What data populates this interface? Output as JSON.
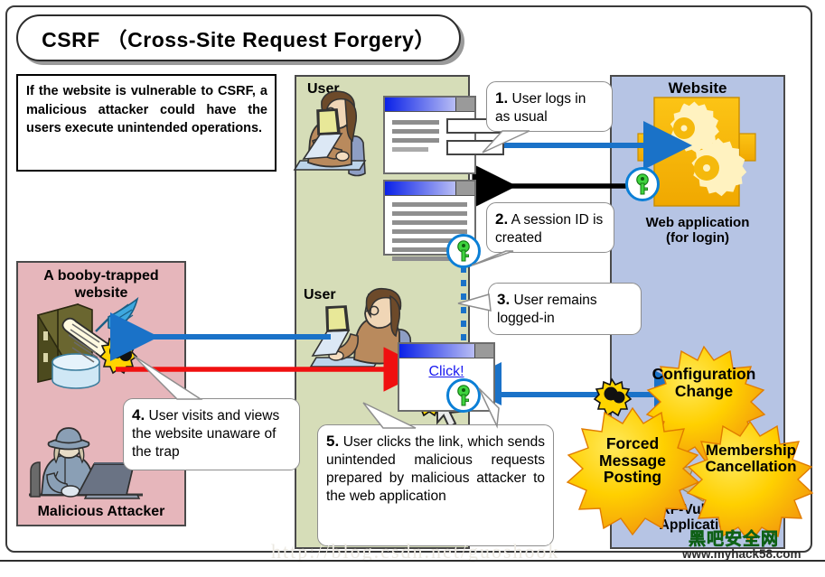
{
  "title": "CSRF （Cross-Site Request Forgery）",
  "intro": {
    "text": "If the website is vulnerable to CSRF, a malicious attacker could have the users execute unintended operations."
  },
  "panels": {
    "user_panel": {
      "label_top": "User",
      "label_bottom": "User",
      "color": "#d6ddb8"
    },
    "website_panel": {
      "label": "Website",
      "webapp_caption_line1": "Web application",
      "webapp_caption_line2": "(for login)",
      "csrf_caption_line1": "CSRF-Vulnerable",
      "csrf_caption_line2": "Application",
      "color": "#b6c4e4"
    },
    "attacker_panel": {
      "label_line1": "A booby-trapped",
      "label_line2": "website",
      "attacker_label": "Malicious Attacker",
      "color": "#e6b6bb"
    }
  },
  "steps": [
    {
      "num": "1.",
      "text": "User logs in as usual"
    },
    {
      "num": "2.",
      "text": "A session ID is created"
    },
    {
      "num": "3.",
      "text": "User  remains logged-in"
    },
    {
      "num": "4.",
      "text": "User visits and views the website unaware of the trap"
    },
    {
      "num": "5.",
      "text": "User clicks the link, which sends unintended malicious requests prepared by malicious attacker to the web application"
    }
  ],
  "link": {
    "label": "Click!"
  },
  "bursts": [
    {
      "id": "configuration-change",
      "line1": "Configuration",
      "line2": "Change"
    },
    {
      "id": "forced-message-posting",
      "line1": "Forced",
      "line2": "Message",
      "line3": "Posting"
    },
    {
      "id": "membership-cancellation",
      "line1": "Membership",
      "line2": "Cancellation"
    }
  ],
  "watermark": {
    "chinese": "黑吧安全网",
    "url": "www.myhack58.com",
    "faint": "http://blog.csdn.net/guoshook"
  },
  "colors": {
    "arrow_blue": "#1a72c8",
    "arrow_red": "#f01010",
    "arrow_black": "#000000",
    "key_green": "#3fd43f",
    "gear_yellow": "#f5b90c",
    "burst_yellow": "#ffd000",
    "burst_orange": "#f29a1e"
  }
}
